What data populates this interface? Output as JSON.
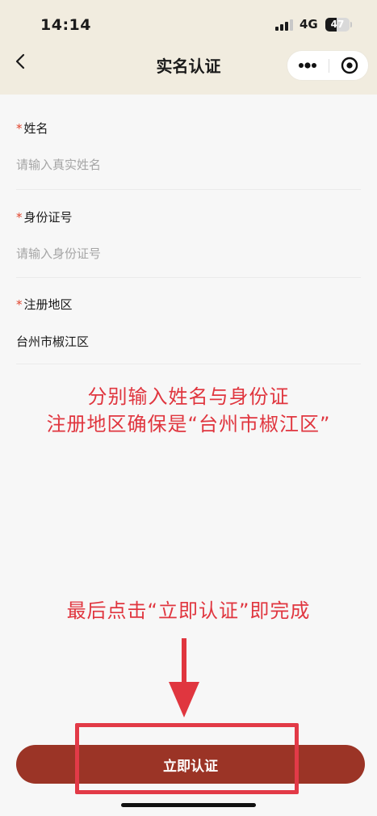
{
  "status_bar": {
    "time": "14:14",
    "network": "4G",
    "battery_level": "47",
    "battery_fraction": 0.47
  },
  "nav": {
    "back_icon": "chevron-left-icon",
    "title": "实名认证",
    "more_icon": "more-dots-icon",
    "close_icon": "target-circle-icon"
  },
  "form": {
    "required_mark": "*",
    "fields": [
      {
        "label": "姓名",
        "placeholder": "请输入真实姓名",
        "value": ""
      },
      {
        "label": "身份证号",
        "placeholder": "请输入身份证号",
        "value": ""
      },
      {
        "label": "注册地区",
        "value": "台州市椒江区"
      }
    ]
  },
  "annotations": {
    "line1": "分别输入姓名与身份证",
    "line2": "注册地区确保是“台州市椒江区”",
    "line3": "最后点击“立即认证”即完成",
    "color": "#e0363f"
  },
  "submit": {
    "label": "立即认证",
    "color": "#9b3426"
  },
  "theme": {
    "header_bg": "#f1ecdf",
    "required_color": "#e1442d"
  }
}
